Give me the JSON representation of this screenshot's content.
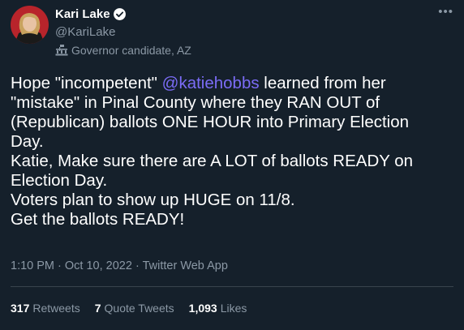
{
  "author": {
    "name": "Kari Lake",
    "handle": "@KariLake",
    "affiliation": "Governor candidate, AZ"
  },
  "tweet": {
    "line1_pre": "Hope \"incompetent\" ",
    "mention": "@katiehobbs",
    "line1_post": " learned from her",
    "line2": "\"mistake\" in Pinal County where they RAN OUT of",
    "line3": "(Republican) ballots ONE HOUR into Primary Election",
    "line4": "Day.",
    "line5": "Katie, Make sure there are A LOT of ballots READY on",
    "line6": "Election Day.",
    "line7": "Voters plan to show up HUGE on 11/8.",
    "line8": "Get the ballots READY!"
  },
  "meta": {
    "time": "1:10 PM",
    "date": "Oct 10, 2022",
    "source": "Twitter Web App",
    "sep": "·"
  },
  "stats": {
    "retweets_count": "317",
    "retweets_label": "Retweets",
    "quotes_count": "7",
    "quotes_label": "Quote Tweets",
    "likes_count": "1,093",
    "likes_label": "Likes"
  },
  "icons": {
    "verified": "verified-badge-icon",
    "affiliation": "government-building-icon",
    "more": "more-horizontal-icon"
  },
  "colors": {
    "background": "#15202b",
    "secondary_text": "#8b98a5",
    "mention": "#7b6cf6",
    "verified": "#1d9bf0"
  }
}
